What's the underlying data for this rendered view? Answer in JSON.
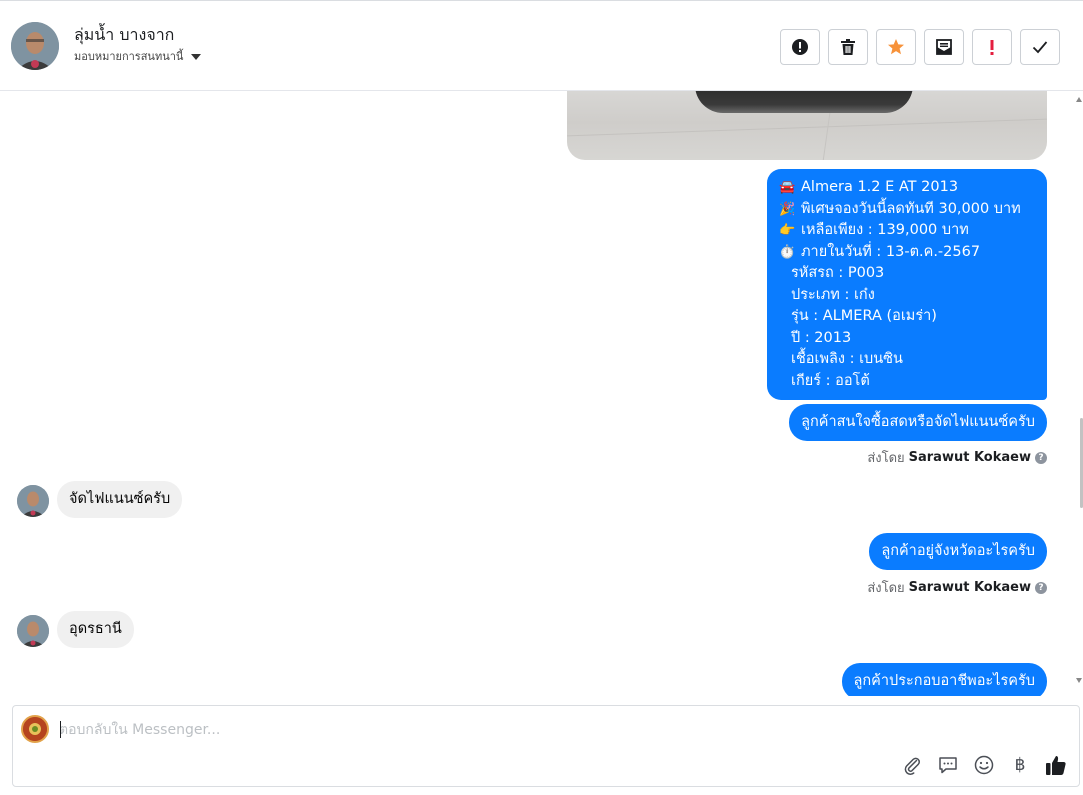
{
  "header": {
    "contact_name": "ลุ่มน้ำ บางจาก",
    "assign_label": "มอบหมายการสนทนานี้",
    "toolbar": [
      {
        "name": "spam-button",
        "icon": "alert-circle-icon"
      },
      {
        "name": "delete-button",
        "icon": "trash-icon"
      },
      {
        "name": "star-button",
        "icon": "star-icon"
      },
      {
        "name": "mark-unread-button",
        "icon": "envelope-icon"
      },
      {
        "name": "follow-up-button",
        "icon": "exclamation-icon"
      },
      {
        "name": "done-button",
        "icon": "check-icon"
      }
    ]
  },
  "colors": {
    "outgoing_bubble": "#0a7cff",
    "incoming_bubble": "#f0f0f0",
    "star": "#f7923a",
    "flag": "#e41e3f"
  },
  "messages": {
    "card": {
      "lines": [
        {
          "emoji": "🚘",
          "text": "Almera 1.2 E AT 2013"
        },
        {
          "emoji": "🎉",
          "text": "พิเศษจองวันนี้ลดทันที 30,000 บาท"
        },
        {
          "emoji": "👉",
          "text": "เหลือเพียง : 139,000 บาท"
        },
        {
          "emoji": "⏱️",
          "text": "ภายในวันที่ : 13-ต.ค.-2567"
        },
        {
          "emoji": "",
          "text": "รหัสรถ : P003"
        },
        {
          "emoji": "",
          "text": "ประเภท : เก๋ง"
        },
        {
          "emoji": "",
          "text": "รุ่น : ALMERA (อเมร่า)"
        },
        {
          "emoji": "",
          "text": "ปี : 2013"
        },
        {
          "emoji": "",
          "text": "เชื้อเพลิง : เบนซิน"
        },
        {
          "emoji": "",
          "text": "เกียร์ : ออโต้"
        }
      ]
    },
    "out_1": "ลูกค้าสนใจซื้อสดหรือจัดไฟแนนซ์ครับ",
    "sent_by_prefix": "ส่งโดย",
    "sent_by_name": "Sarawut Kokaew",
    "in_1": "จัดไฟแนนซ์ครับ",
    "out_2": "ลูกค้าอยู่จังหวัดอะไรครับ",
    "in_2": "อุดรธานี",
    "out_3": "ลูกค้าประกอบอาชีพอะไรครับ"
  },
  "composer": {
    "placeholder": "ตอบกลับใน Messenger...",
    "tools": [
      "paperclip-icon",
      "saved-reply-icon",
      "emoji-icon",
      "baht-icon",
      "thumbs-up-icon"
    ],
    "baht_symbol": "฿"
  }
}
